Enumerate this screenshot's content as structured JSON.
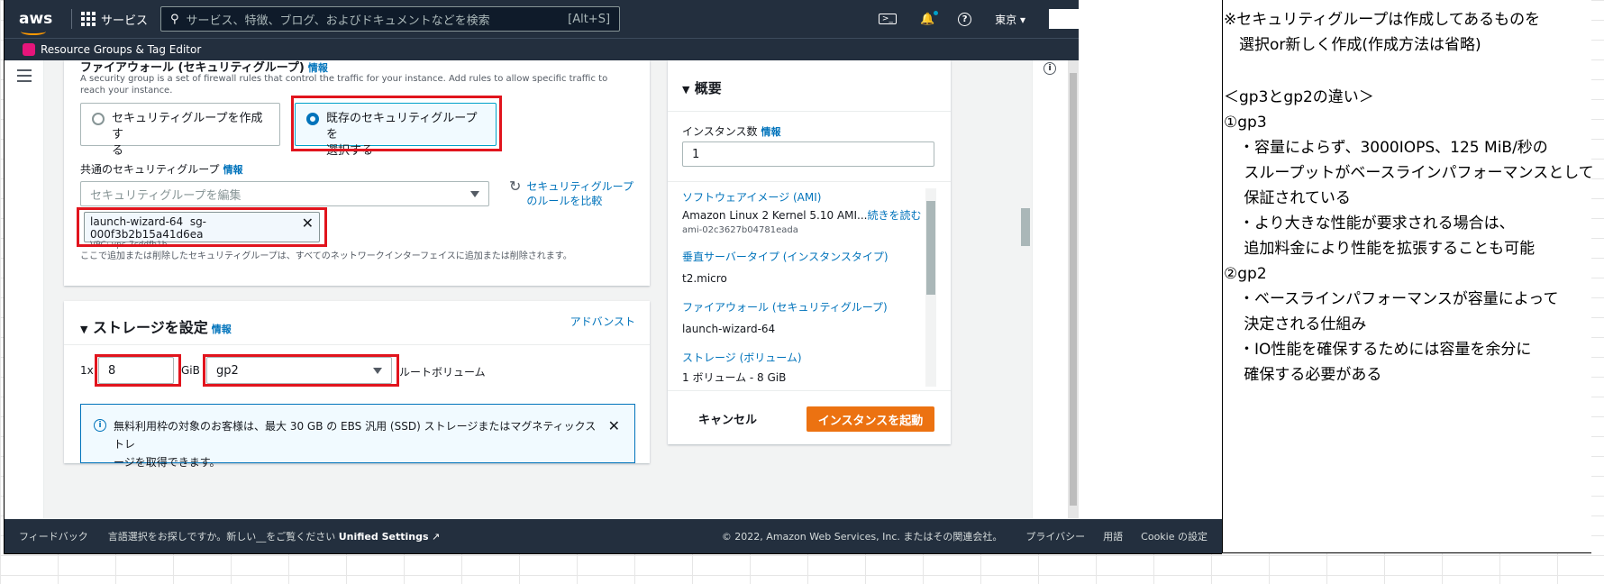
{
  "topnav": {
    "logo": "aws",
    "services_label": "サービス",
    "search_placeholder": "サービス、特徴、ブログ、およびドキュメントなどを検索",
    "search_hint": "[Alt+S]",
    "region": "東京 ▾"
  },
  "service_bar": {
    "label": "Resource Groups & Tag Editor"
  },
  "firewall": {
    "title": "ファイアウォール (セキュリティグループ)",
    "info": "情報",
    "description": "A security group is a set of firewall rules that control the traffic for your instance. Add rules to allow specific traffic to reach your instance.",
    "option_create_1": "セキュリティグループを作成す",
    "option_create_2": "る",
    "option_existing_1": "既存のセキュリティグループを",
    "option_existing_2": "選択する",
    "common_label": "共通のセキュリティグループ",
    "common_info": "情報",
    "select_placeholder": "セキュリティグループを編集",
    "compare_1": "セキュリティグループ",
    "compare_2": "のルールを比較",
    "token_name": "launch-wizard-64",
    "token_id": "sg-000f3b2b15a41d6ea",
    "token_vpc": "VPC: vpc-7cddfb1b",
    "note": "ここで追加または削除したセキュリティグループは、すべてのネットワークインターフェイスに追加または削除されます。"
  },
  "storage": {
    "title": "ストレージを設定",
    "info": "情報",
    "advanced": "アドバンスト",
    "count_prefix": "1x",
    "size": "8",
    "unit": "GiB",
    "volume_type": "gp2",
    "root_label": "ルートボリューム",
    "alert_1": "無料利用枠の対象のお客様は、最大 30 GB の EBS 汎用 (SSD) ストレージまたはマグネティックストレ",
    "alert_2": "ージを取得できます。"
  },
  "summary": {
    "title": "概要",
    "instances_label": "インスタンス数",
    "instances_info": "情報",
    "instances_value": "1",
    "ami_label": "ソフトウェアイメージ (AMI)",
    "ami_value": "Amazon Linux 2 Kernel 5.10 AMI...",
    "ami_more": "続きを読む",
    "ami_id": "ami-02c3627b04781eada",
    "type_label": "垂直サーバータイプ (インスタンスタイプ)",
    "type_value": "t2.micro",
    "fw_label": "ファイアウォール (セキュリティグループ)",
    "fw_value": "launch-wizard-64",
    "storage_label": "ストレージ (ボリューム)",
    "storage_value": "1 ボリューム - 8 GiB",
    "cancel": "キャンセル",
    "launch": "インスタンスを起動"
  },
  "footer": {
    "feedback": "フィードバック",
    "lang": "言語選択をお探しですか。新しい__をご覧ください",
    "unified": "Unified Settings",
    "copyright": "© 2022, Amazon Web Services, Inc. またはその関連会社。",
    "privacy": "プライバシー",
    "terms": "用語",
    "cookie": "Cookie の設定"
  },
  "notes": {
    "l1": "※セキュリティグループは作成してあるものを",
    "l2": "　選択or新しく作成(作成方法は省略)",
    "l3": "",
    "l4": "＜gp3とgp2の違い＞",
    "l5": "①gp3",
    "l6": "　・容量によらず、3000IOPS、125 MiB/秒の",
    "l7": "　 スループットがベースラインパフォーマンスとして",
    "l8": "　 保証されている",
    "l9": "　・より大きな性能が要求される場合は、",
    "l10": "　 追加料金により性能を拡張することも可能",
    "l11": "②gp2",
    "l12": "　・ベースラインパフォーマンスが容量によって",
    "l13": "　 決定される仕組み",
    "l14": "　・IO性能を確保するためには容量を余分に",
    "l15": "　 確保する必要がある"
  }
}
